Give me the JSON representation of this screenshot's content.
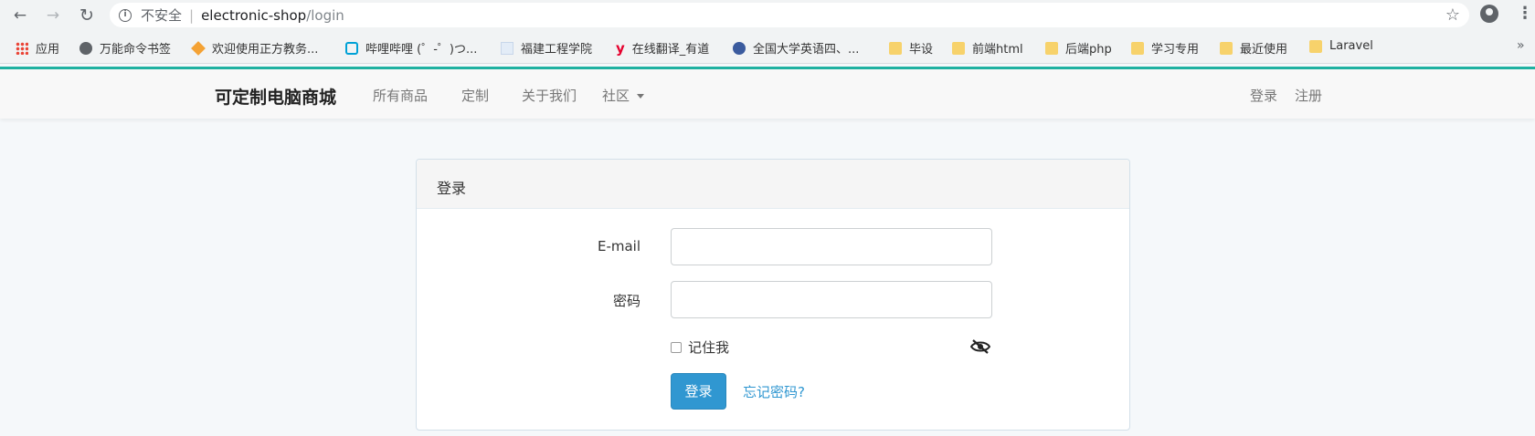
{
  "browser": {
    "insecure_label": "不安全",
    "url_separator": "|",
    "url_host": "electronic-shop",
    "url_path": "/login",
    "back_icon": "←",
    "forward_icon": "→",
    "reload_icon": "↻",
    "star_icon": "☆",
    "menu_icon": "⋮"
  },
  "bookmarks": [
    {
      "label": "应用",
      "icon": "apps-icon"
    },
    {
      "label": "万能命令书签",
      "icon": "globe-icon"
    },
    {
      "label": "欢迎使用正方教务...",
      "icon": "cube-icon"
    },
    {
      "label": "哔哩哔哩 (゜-゜)つ...",
      "icon": "bilibili-icon"
    },
    {
      "label": "福建工程学院",
      "icon": "page-icon"
    },
    {
      "label": "在线翻译_有道",
      "icon": "youdao-icon"
    },
    {
      "label": "全国大学英语四、...",
      "icon": "seal-icon"
    },
    {
      "label": "毕设",
      "icon": "folder-icon"
    },
    {
      "label": "前端html",
      "icon": "folder-icon"
    },
    {
      "label": "后端php",
      "icon": "folder-icon"
    },
    {
      "label": "学习专用",
      "icon": "folder-icon"
    },
    {
      "label": "最近使用",
      "icon": "folder-icon"
    },
    {
      "label": "Laravel",
      "icon": "folder-icon"
    }
  ],
  "bookmarks_more": "»",
  "navbar": {
    "brand": "可定制电脑商城",
    "links": [
      "所有商品",
      "定制",
      "关于我们",
      "社区"
    ],
    "right_links": [
      "登录",
      "注册"
    ]
  },
  "login_panel": {
    "heading": "登录",
    "email_label": "E-mail",
    "email_value": "",
    "password_label": "密码",
    "password_value": "",
    "remember_label": "记住我",
    "submit_label": "登录",
    "forgot_label": "忘记密码?"
  },
  "colors": {
    "accent": "#3097d1",
    "navbar_top_line": "#1fb1a1"
  }
}
